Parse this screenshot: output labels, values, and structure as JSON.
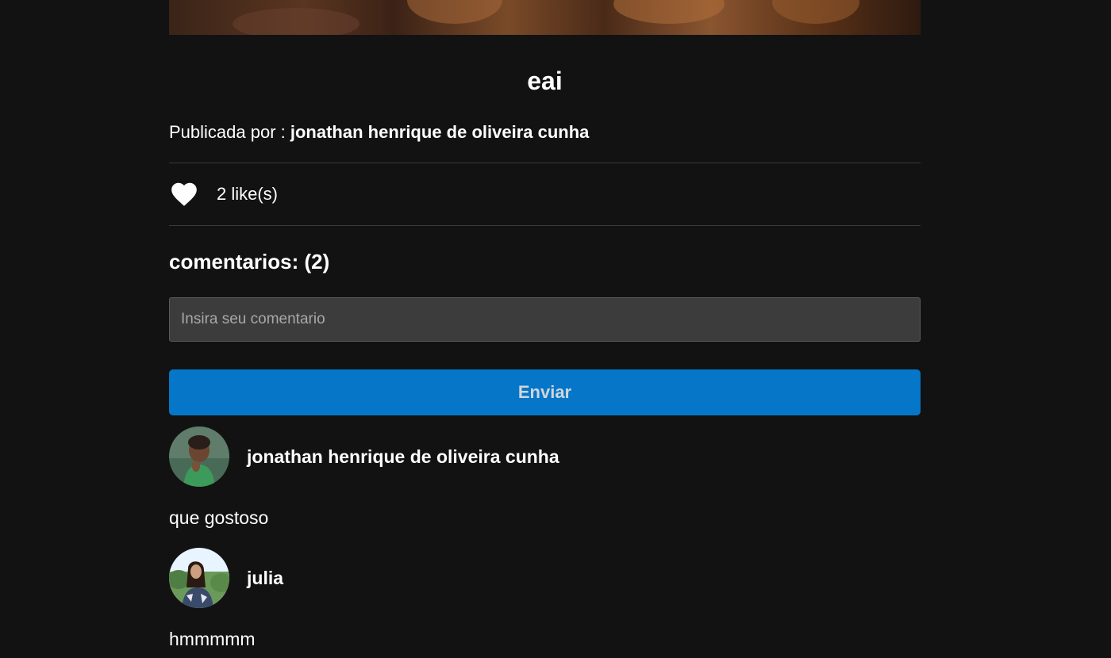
{
  "post": {
    "title": "eai",
    "author_prefix": "Publicada por : ",
    "author_name": "jonathan henrique de oliveira cunha",
    "likes_label": "2 like(s)"
  },
  "comments_section": {
    "title": "comentarios: (2)",
    "input_placeholder": "Insira seu comentario",
    "input_value": "",
    "send_label": "Enviar"
  },
  "comments": [
    {
      "author": "jonathan henrique de oliveira cunha",
      "text": "que gostoso"
    },
    {
      "author": "julia",
      "text": "hmmmmm"
    }
  ],
  "icons": {
    "like": "heart-icon"
  },
  "colors": {
    "background": "#121212",
    "accent": "#0576c8",
    "input_bg": "#3c3c3c"
  }
}
